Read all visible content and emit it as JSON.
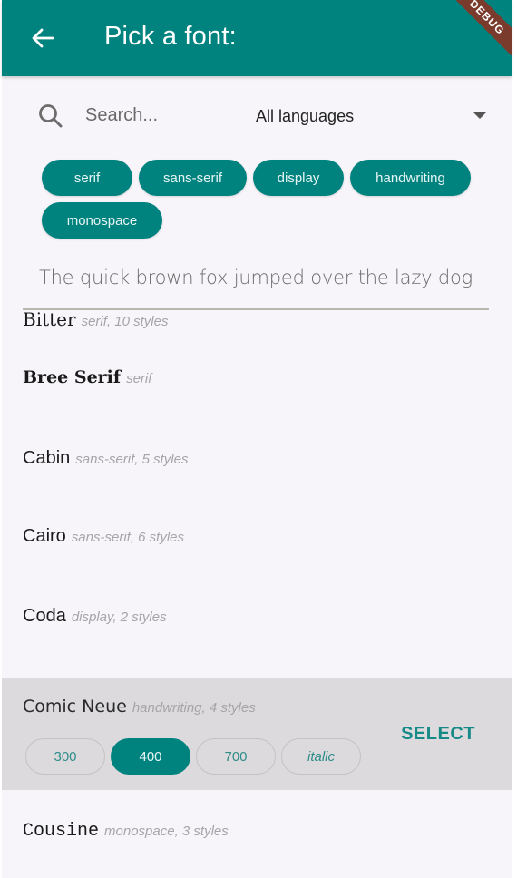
{
  "appbar": {
    "title": "Pick a font:",
    "back_icon": "arrow-left-icon",
    "debug_banner": "DEBUG",
    "color": "#00837f"
  },
  "search": {
    "icon": "search-icon",
    "placeholder": "Search...",
    "value": ""
  },
  "language_filter": {
    "selected": "All languages",
    "icon": "dropdown-arrow-icon"
  },
  "categories": [
    {
      "label": "serif"
    },
    {
      "label": "sans-serif"
    },
    {
      "label": "display"
    },
    {
      "label": "handwriting"
    },
    {
      "label": "monospace"
    }
  ],
  "preview": {
    "value": "The quick brown fox jumped over the lazy dog"
  },
  "fonts": [
    {
      "name": "Bitter",
      "meta": "serif, 10 styles"
    },
    {
      "name": "Bree Serif",
      "meta": "serif"
    },
    {
      "name": "Cabin",
      "meta": "sans-serif, 5 styles"
    },
    {
      "name": "Cairo",
      "meta": "sans-serif, 6 styles"
    },
    {
      "name": "Coda",
      "meta": "display, 2 styles"
    },
    {
      "name": "Comic Neue",
      "meta": "handwriting, 4 styles",
      "selected": true,
      "variants": [
        {
          "label": "300",
          "active": false
        },
        {
          "label": "400",
          "active": true
        },
        {
          "label": "700",
          "active": false
        },
        {
          "label": "italic",
          "active": false
        }
      ],
      "select_label": "SELECT"
    },
    {
      "name": "Cousine",
      "meta": "monospace, 3 styles"
    }
  ],
  "colors": {
    "accent": "#00837f",
    "selected_row_bg": "#dcdadd",
    "background": "#f7f5f9",
    "meta_text": "#a5a5a8"
  }
}
